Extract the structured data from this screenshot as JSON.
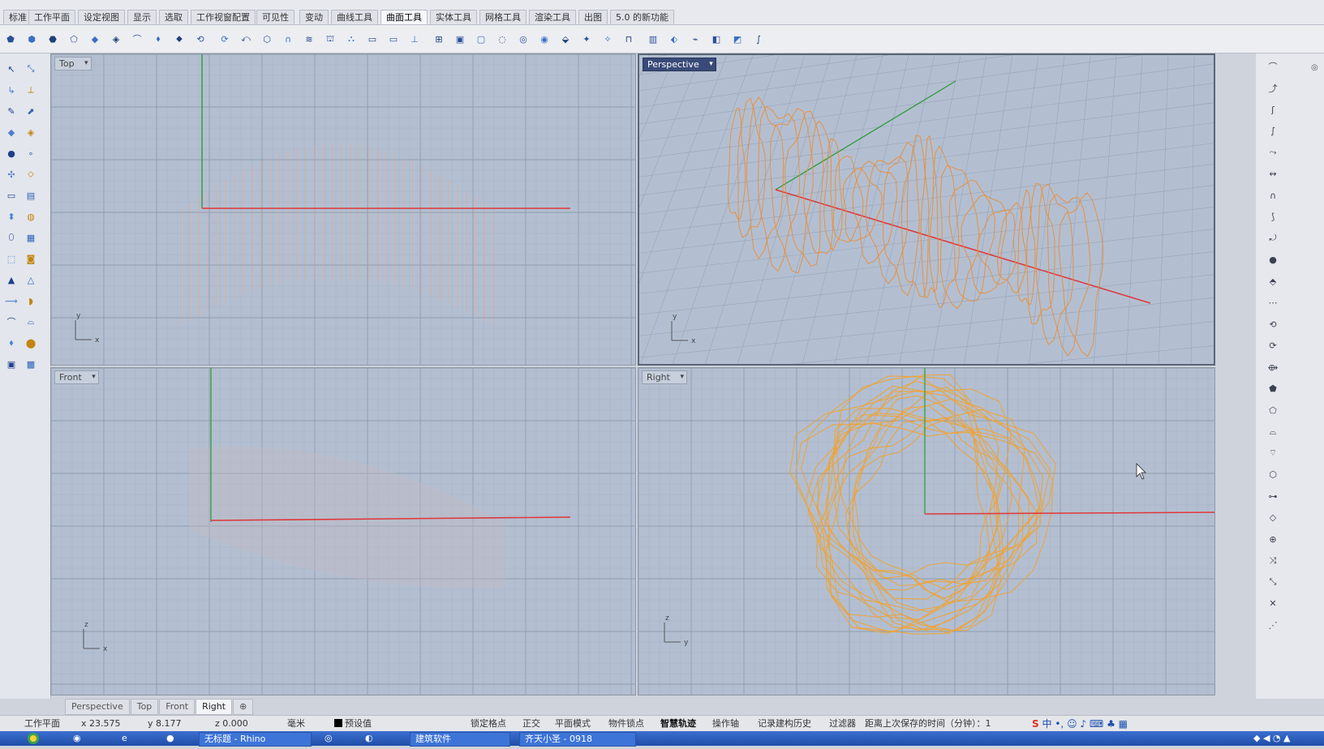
{
  "menu_tabs": [
    "标准",
    "工作平面",
    "设定视图",
    "显示",
    "选取",
    "工作视窗配置",
    "可见性",
    "变动",
    "曲线工具",
    "曲面工具",
    "实体工具",
    "网格工具",
    "渲染工具",
    "出图",
    "5.0 的新功能"
  ],
  "active_tab_index": 9,
  "viewports": {
    "top": {
      "title": "Top"
    },
    "perspective": {
      "title": "Perspective"
    },
    "front": {
      "title": "Front"
    },
    "right": {
      "title": "Right"
    }
  },
  "axis_labels": {
    "x": "x",
    "y": "y",
    "z": "z"
  },
  "viewport_tabs": [
    "Perspective",
    "Top",
    "Front",
    "Right",
    "⊕"
  ],
  "status": {
    "cplane": "工作平面",
    "x": "x 23.575",
    "y": "y 8.177",
    "z": "z 0.000",
    "unit": "毫米",
    "layer": "预设值",
    "grid_snap": "锁定格点",
    "ortho": "正交",
    "planar": "平面模式",
    "osnap": "物件锁点",
    "smart_track": "智慧轨迹",
    "gumball": "操作轴",
    "history": "记录建构历史",
    "filter": "过滤器",
    "autosave": "距离上次保存的时间（分钟）：1"
  },
  "ime": {
    "lang": "中"
  },
  "taskbar": {
    "task1": "无标题 - Rhino",
    "task2": "建筑软件",
    "task3": "齐天小圣 - 0918"
  },
  "colors": {
    "accent": "#3a4a78",
    "x_axis": "#e0363a",
    "y_axis": "#2e9a3a",
    "curves": "#f08a2a"
  }
}
